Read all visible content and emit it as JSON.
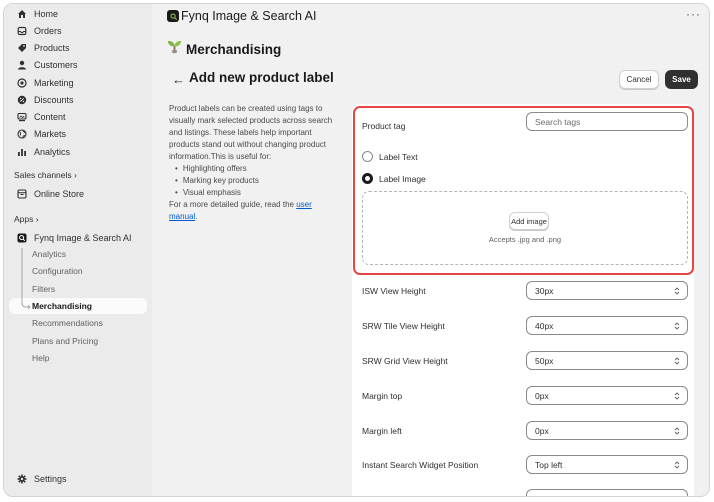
{
  "sidebar": {
    "items": [
      {
        "label": "Home",
        "icon": "home-icon"
      },
      {
        "label": "Orders",
        "icon": "inbox-icon"
      },
      {
        "label": "Products",
        "icon": "tag-icon"
      },
      {
        "label": "Customers",
        "icon": "person-icon"
      },
      {
        "label": "Marketing",
        "icon": "target-icon"
      },
      {
        "label": "Discounts",
        "icon": "discount-icon"
      },
      {
        "label": "Content",
        "icon": "content-icon"
      },
      {
        "label": "Markets",
        "icon": "globe-icon"
      },
      {
        "label": "Analytics",
        "icon": "bar-chart-icon"
      }
    ],
    "sales_channels_label": "Sales channels",
    "online_store": "Online Store",
    "apps_label": "Apps",
    "app_name": "Fynq Image & Search AI",
    "sub_items": [
      "Analytics",
      "Configuration",
      "Filters",
      "Merchandising",
      "Recommendations",
      "Plans and Pricing",
      "Help"
    ],
    "settings": "Settings"
  },
  "header": {
    "app_title": "Fynq Image & Search AI",
    "more": "···",
    "section_title": "Merchandising"
  },
  "page": {
    "back": "←",
    "title": "Add new product label",
    "cancel": "Cancel",
    "save": "Save"
  },
  "description": {
    "intro": "Product labels can be created using tags to visually mark selected products across search and listings. These labels help important products stand out without changing product information.This is useful for:",
    "bullets": [
      "Highlighting offers",
      "Marking key products",
      "Visual emphasis"
    ],
    "guide_prefix": "For a more detailed guide, read the",
    "guide_link": "user manual",
    "guide_suffix": "."
  },
  "form": {
    "product_tag_label": "Product tag",
    "product_tag_placeholder": "Search tags",
    "radio_text": "Label Text",
    "radio_image": "Label Image",
    "selected": "Label Image",
    "add_image": "Add image",
    "accepts": "Accepts .jpg and .png",
    "fields": [
      {
        "label": "ISW View Height",
        "value": "30px"
      },
      {
        "label": "SRW Tile View Height",
        "value": "40px"
      },
      {
        "label": "SRW Grid View Height",
        "value": "50px"
      },
      {
        "label": "Margin top",
        "value": "0px"
      },
      {
        "label": "Margin left",
        "value": "0px"
      },
      {
        "label": "Instant Search Widget Position",
        "value": "Top left"
      }
    ]
  },
  "colors": {
    "highlight": "#e64545",
    "link": "#005bd3",
    "save_bg": "#303030",
    "brand_leaf": "#7cb342"
  }
}
